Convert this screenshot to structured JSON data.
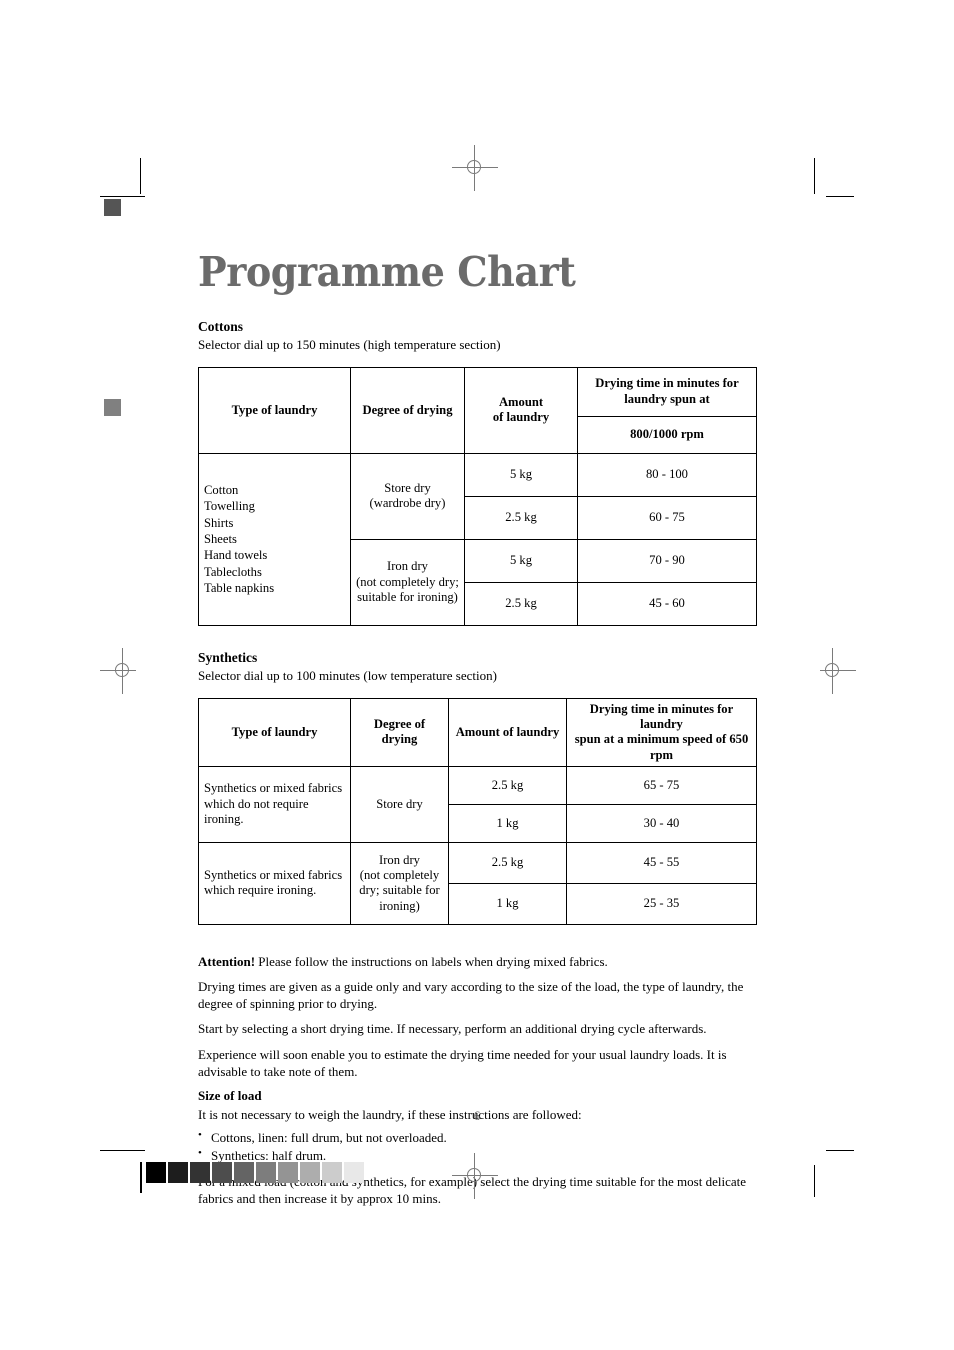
{
  "document": {
    "title": "Programme Chart",
    "page_number": "6"
  },
  "cottons": {
    "heading": "Cottons",
    "subheading": "Selector dial up to 150 minutes (high temperature section)",
    "headers": {
      "type_of_laundry": "Type of laundry",
      "degree_of_drying": "Degree of drying",
      "amount_of_laundry_line1": "Amount",
      "amount_of_laundry_line2": "of laundry",
      "drying_time_line1": "Drying time in minutes for",
      "drying_time_line2": "laundry spun at",
      "spin_speed": "800/1000 rpm"
    },
    "laundry_types": [
      "Cotton",
      "Towelling",
      "Shirts",
      "Sheets",
      "Hand towels",
      "Tablecloths",
      "Table napkins"
    ],
    "groups": [
      {
        "degree_line1": "Store dry",
        "degree_line2": "(wardrobe dry)",
        "degree_line3": "",
        "rows": [
          {
            "amount": "5 kg",
            "time": "80 - 100"
          },
          {
            "amount": "2.5 kg",
            "time": "60 - 75"
          }
        ]
      },
      {
        "degree_line1": "Iron dry",
        "degree_line2": "(not completely dry;",
        "degree_line3": "suitable for ironing)",
        "rows": [
          {
            "amount": "5 kg",
            "time": "70 - 90"
          },
          {
            "amount": "2.5 kg",
            "time": "45 - 60"
          }
        ]
      }
    ]
  },
  "synthetics": {
    "heading": "Synthetics",
    "subheading": "Selector dial up to 100 minutes (low temperature section)",
    "headers": {
      "type_of_laundry": "Type of laundry",
      "degree_of_drying": "Degree of drying",
      "amount_of_laundry": "Amount of laundry",
      "drying_time_line1": "Drying time in minutes for laundry",
      "drying_time_line2": "spun at a minimum speed of 650 rpm"
    },
    "groups": [
      {
        "type_line1": "Synthetics or mixed fabrics",
        "type_line2": "which do not require",
        "type_line3": "ironing.",
        "degree_line1": "Store dry",
        "degree_line2": "",
        "degree_line3": "",
        "degree_line4": "",
        "rows": [
          {
            "amount": "2.5 kg",
            "time": "65 - 75"
          },
          {
            "amount": "1 kg",
            "time": "30 - 40"
          }
        ]
      },
      {
        "type_line1": "Synthetics or mixed fabrics",
        "type_line2": "which require ironing.",
        "type_line3": "",
        "degree_line1": "Iron dry",
        "degree_line2": "(not completely",
        "degree_line3": "dry; suitable for",
        "degree_line4": "ironing)",
        "rows": [
          {
            "amount": "2.5 kg",
            "time": "45 - 55"
          },
          {
            "amount": "1 kg",
            "time": "25 - 35"
          }
        ]
      }
    ]
  },
  "notes": {
    "attention_label": "Attention!",
    "attention_text": " Please follow the instructions on labels when drying mixed fabrics.",
    "para_guide": "Drying times are given as a guide only and vary according to the size of the load, the type of laundry, the degree of spinning prior to drying.",
    "para_short_cycle": "Start by selecting a short drying time. If necessary, perform an additional drying cycle afterwards.",
    "para_experience": "Experience will soon enable you to estimate the drying time needed for your usual laundry loads. It is advisable to take note of them."
  },
  "size_of_load": {
    "heading": "Size of load",
    "intro": "It is not necessary to weigh the laundry, if these instructions are followed:",
    "bullets": [
      "Cottons, linen: full drum, but not overloaded.",
      "Synthetics: half drum."
    ],
    "closing": "For a mixed load (cotton and synthetics, for example) select the drying time suitable for the most delicate fabrics and then increase it by approx 10 mins."
  },
  "print_marks": {
    "title_color": "#6b6b6b",
    "margin_square_dark": "#555555",
    "margin_square_light": "#808080",
    "grayscale_strip": [
      "#000000",
      "#1d1d1d",
      "#333333",
      "#4d4d4d",
      "#646464",
      "#7d7d7d",
      "#949494",
      "#adadad",
      "#cccccc",
      "#e8e8e8"
    ]
  }
}
